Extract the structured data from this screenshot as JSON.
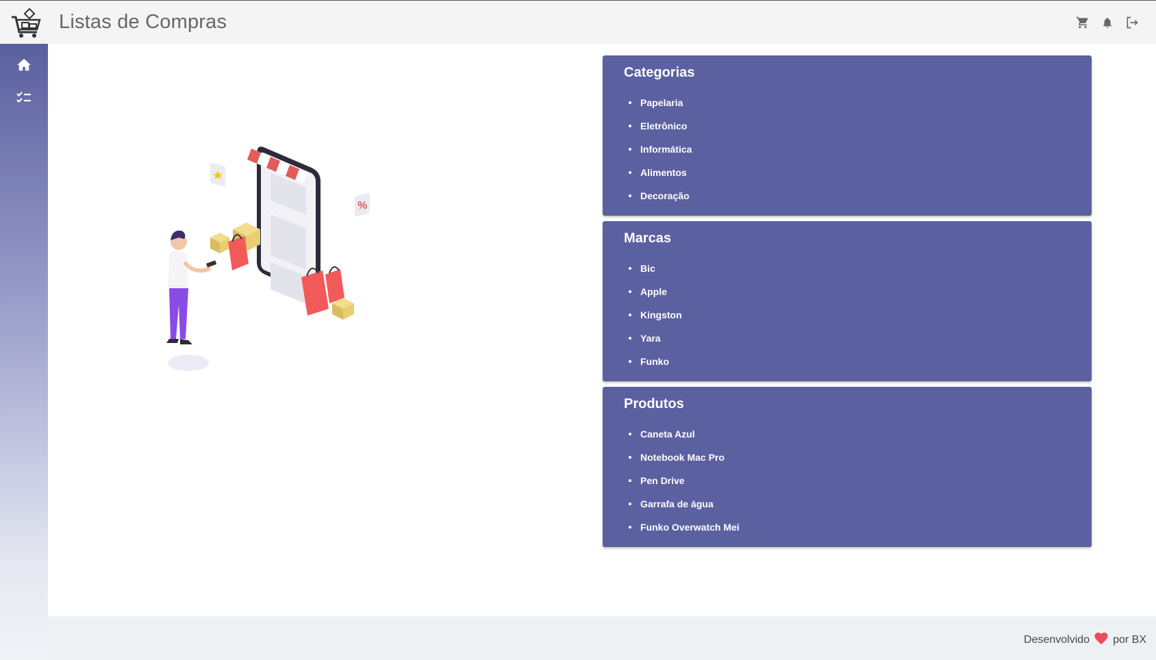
{
  "header": {
    "title": "Listas de Compras",
    "actions": [
      {
        "icon": "cart-icon"
      },
      {
        "icon": "bell-icon"
      },
      {
        "icon": "logout-icon"
      }
    ]
  },
  "sidebar": {
    "items": [
      {
        "icon": "home-icon",
        "active": true
      },
      {
        "icon": "checklist-icon"
      }
    ]
  },
  "illustration": {
    "icon": "shopping-illustration"
  },
  "cards": [
    {
      "title": "Categorias",
      "items": [
        "Papelaria",
        "Eletrônico",
        "Informática",
        "Alimentos",
        "Decoração"
      ]
    },
    {
      "title": "Marcas",
      "items": [
        "Bic",
        "Apple",
        "Kingston",
        "Yara",
        "Funko"
      ]
    },
    {
      "title": "Produtos",
      "items": [
        "Caneta Azul",
        "Notebook Mac Pro",
        "Pen Drive",
        "Garrafa de água",
        "Funko Overwatch Mei"
      ]
    }
  ],
  "footer": {
    "text_before": "Desenvolvido",
    "text_after": "por BX",
    "heart_color": "#ea4c5f"
  },
  "colors": {
    "card_bg": "#5b60a0",
    "header_bg": "#f4f4f4",
    "footer_bg": "#edf1f4"
  }
}
